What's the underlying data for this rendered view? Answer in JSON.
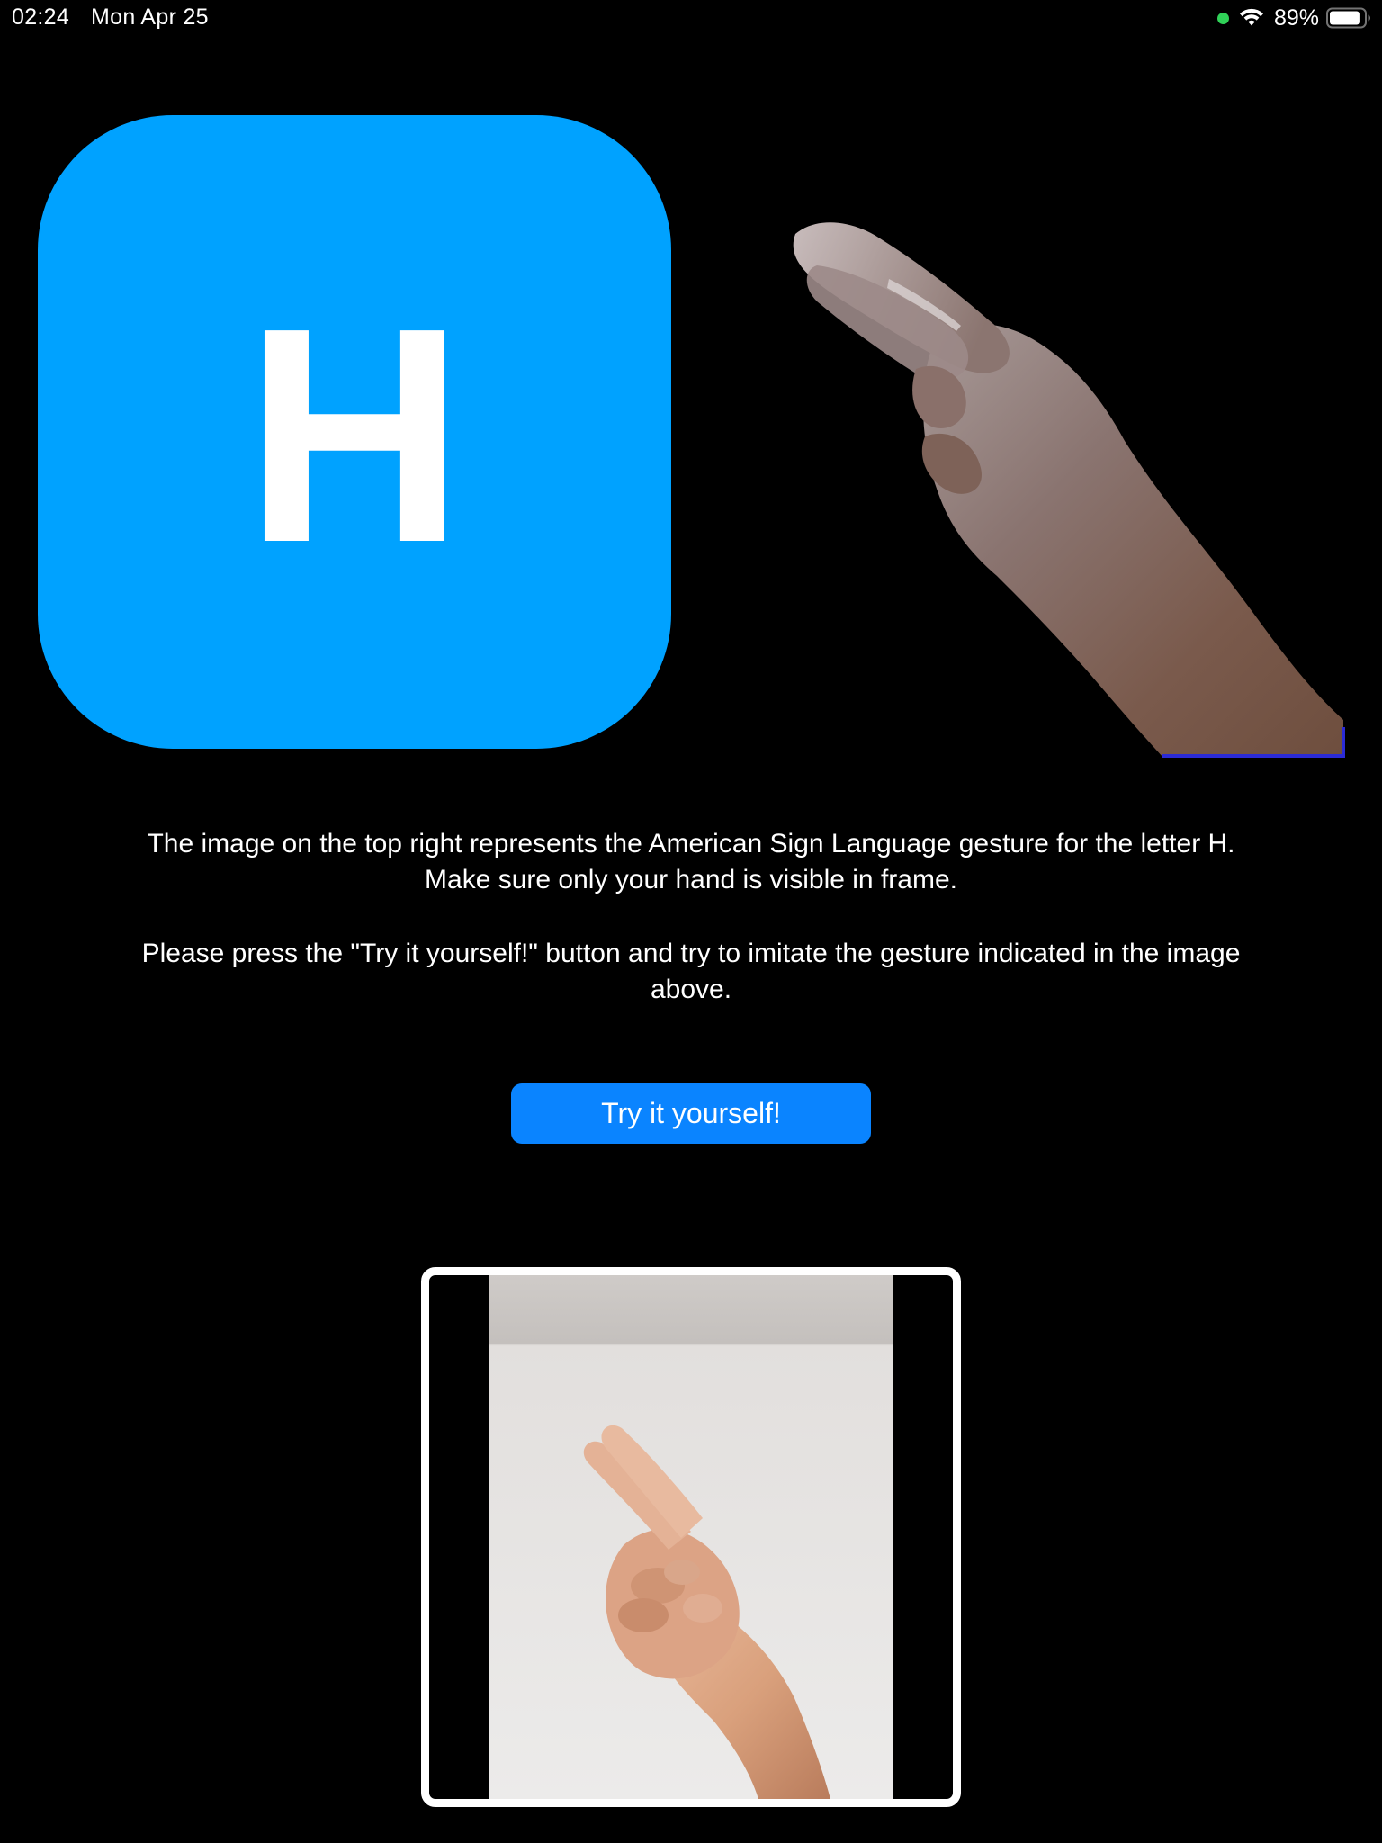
{
  "status_bar": {
    "time": "02:24",
    "date": "Mon Apr 25",
    "battery_percent": "89%",
    "battery_level": 0.89,
    "indicator_color": "#30d158",
    "icons": [
      "green-dot-indicator",
      "wifi-icon",
      "battery-icon"
    ]
  },
  "lesson": {
    "letter": "H",
    "tile_color": "#00a2ff",
    "reference_image_icon": "hand-sign-icon"
  },
  "instructions": {
    "line1": "The image on the top right represents the American Sign Language gesture for the letter H.",
    "line2": "Make sure only your hand is visible in frame.",
    "line3": "Please press the \"Try it yourself!\" button and try to imitate the gesture indicated in the image above."
  },
  "button": {
    "label": "Try it yourself!",
    "color": "#0a84ff"
  },
  "camera": {
    "frame_color": "#ffffff",
    "feed_icon": "camera-hand-feed"
  }
}
